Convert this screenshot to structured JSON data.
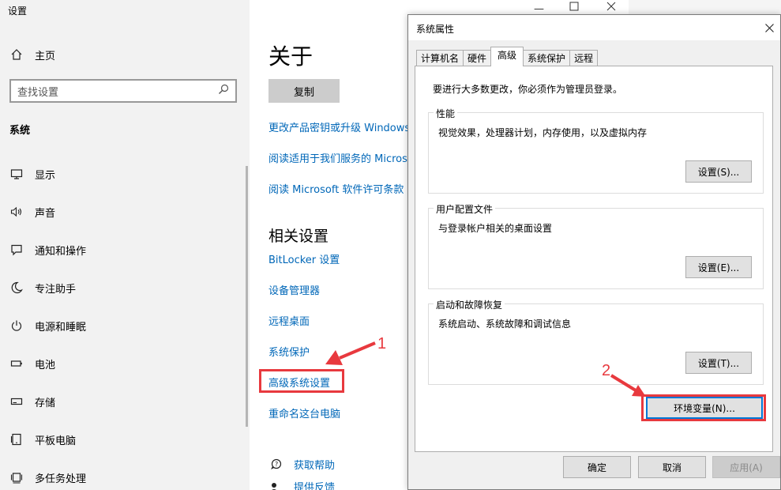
{
  "settings": {
    "app_title": "设置",
    "home_label": "主页",
    "search_placeholder": "查找设置",
    "section_title": "系统",
    "nav_items": [
      {
        "label": "显示",
        "icon": "monitor-icon"
      },
      {
        "label": "声音",
        "icon": "speaker-icon"
      },
      {
        "label": "通知和操作",
        "icon": "notification-icon"
      },
      {
        "label": "专注助手",
        "icon": "moon-icon"
      },
      {
        "label": "电源和睡眠",
        "icon": "power-icon"
      },
      {
        "label": "电池",
        "icon": "battery-icon"
      },
      {
        "label": "存储",
        "icon": "storage-icon"
      },
      {
        "label": "平板电脑",
        "icon": "tablet-icon"
      },
      {
        "label": "多任务处理",
        "icon": "multitask-icon"
      }
    ]
  },
  "about": {
    "title": "关于",
    "copy_button": "复制",
    "links": [
      "更改产品密钥或升级 Windows",
      "阅读适用于我们服务的 Microsoft 服务协议",
      "阅读 Microsoft 软件许可条款"
    ],
    "related_title": "相关设置",
    "related_links": [
      "BitLocker 设置",
      "设备管理器",
      "远程桌面",
      "系统保护",
      "高级系统设置",
      "重命名这台电脑"
    ],
    "help_links": [
      {
        "label": "获取帮助",
        "icon": "help-chat-icon"
      },
      {
        "label": "提供反馈",
        "icon": "feedback-icon"
      }
    ]
  },
  "dialog": {
    "title": "系统属性",
    "tabs": [
      "计算机名",
      "硬件",
      "高级",
      "系统保护",
      "远程"
    ],
    "active_tab": "高级",
    "admin_note": "要进行大多数更改，你必须作为管理员登录。",
    "groups": [
      {
        "legend": "性能",
        "description": "视觉效果，处理器计划，内存使用，以及虚拟内存",
        "button": "设置(S)..."
      },
      {
        "legend": "用户配置文件",
        "description": "与登录帐户相关的桌面设置",
        "button": "设置(E)..."
      },
      {
        "legend": "启动和故障恢复",
        "description": "系统启动、系统故障和调试信息",
        "button": "设置(T)..."
      }
    ],
    "env_button": "环境变量(N)...",
    "ok_button": "确定",
    "cancel_button": "取消",
    "apply_button": "应用(A)"
  },
  "annotations": {
    "step1": "1",
    "step2": "2",
    "color": "#e8393e"
  },
  "colors": {
    "link": "#0067b8",
    "focus": "#0078d7"
  }
}
